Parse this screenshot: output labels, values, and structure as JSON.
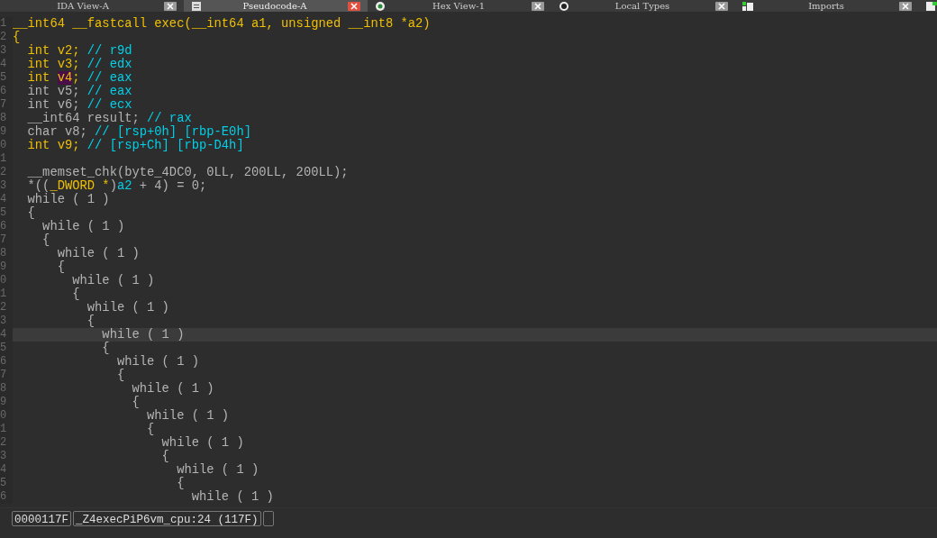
{
  "tabs": [
    {
      "label": "IDA View-A",
      "selected": false
    },
    {
      "label": "Pseudocode-A",
      "selected": true
    },
    {
      "label": "Hex View-1",
      "selected": false
    },
    {
      "label": "Local Types",
      "selected": false
    },
    {
      "label": "Imports",
      "selected": false
    }
  ],
  "code": {
    "lines": [
      {
        "number": "1",
        "current": false,
        "tokens": [
          {
            "kind": "name",
            "text": "__int64 __fastcall exec(__int64 a1, unsigned __int8 *a2)"
          }
        ]
      },
      {
        "number": "2",
        "current": false,
        "tokens": [
          {
            "kind": "name",
            "text": "{"
          }
        ]
      },
      {
        "number": "3",
        "current": false,
        "tokens": [
          {
            "kind": "name",
            "text": "  int v2; "
          },
          {
            "kind": "comment",
            "text": "// r9d"
          }
        ]
      },
      {
        "number": "4",
        "current": false,
        "tokens": [
          {
            "kind": "name",
            "text": "  int v3; "
          },
          {
            "kind": "comment",
            "text": "// edx"
          }
        ]
      },
      {
        "number": "5",
        "current": false,
        "tokens": [
          {
            "kind": "name",
            "text": "  int "
          },
          {
            "kind": "highlight",
            "text": "v4"
          },
          {
            "kind": "name",
            "text": "; "
          },
          {
            "kind": "comment",
            "text": "// eax"
          }
        ]
      },
      {
        "number": "6",
        "current": false,
        "tokens": [
          {
            "kind": "code",
            "text": "  int v5; "
          },
          {
            "kind": "comment",
            "text": "// eax"
          }
        ]
      },
      {
        "number": "7",
        "current": false,
        "tokens": [
          {
            "kind": "code",
            "text": "  int v6; "
          },
          {
            "kind": "comment",
            "text": "// ecx"
          }
        ]
      },
      {
        "number": "8",
        "current": false,
        "tokens": [
          {
            "kind": "code",
            "text": "  __int64 result; "
          },
          {
            "kind": "comment",
            "text": "// rax"
          }
        ]
      },
      {
        "number": "9",
        "current": false,
        "tokens": [
          {
            "kind": "code",
            "text": "  char v8; "
          },
          {
            "kind": "comment",
            "text": "// [rsp+0h] [rbp-E0h]"
          }
        ]
      },
      {
        "number": "0",
        "current": false,
        "tokens": [
          {
            "kind": "name",
            "text": "  int v9; "
          },
          {
            "kind": "comment",
            "text": "// [rsp+Ch] [rbp-D4h]"
          }
        ]
      },
      {
        "number": "1",
        "current": false
      },
      {
        "number": "2",
        "current": false,
        "tokens": [
          {
            "kind": "code",
            "text": "  __memset_chk(byte_4DC0, 0LL, 200LL, 200LL);"
          }
        ]
      },
      {
        "number": "3",
        "current": false,
        "tokens": [
          {
            "kind": "code",
            "text": "  *(("
          },
          {
            "kind": "name",
            "text": "_DWORD *"
          },
          {
            "kind": "code",
            "text": ")"
          },
          {
            "kind": "comment",
            "text": "a2"
          },
          {
            "kind": "code",
            "text": " + 4) = 0;"
          }
        ]
      },
      {
        "number": "4",
        "current": false,
        "tokens": [
          {
            "kind": "code",
            "text": "  while ( 1 )"
          }
        ]
      },
      {
        "number": "5",
        "current": false,
        "tokens": [
          {
            "kind": "code",
            "text": "  {"
          }
        ]
      },
      {
        "number": "6",
        "current": false,
        "tokens": [
          {
            "kind": "code",
            "text": "    while ( 1 )"
          }
        ]
      },
      {
        "number": "7",
        "current": false,
        "tokens": [
          {
            "kind": "code",
            "text": "    {"
          }
        ]
      },
      {
        "number": "8",
        "current": false,
        "tokens": [
          {
            "kind": "code",
            "text": "      while ( 1 )"
          }
        ]
      },
      {
        "number": "9",
        "current": false,
        "tokens": [
          {
            "kind": "code",
            "text": "      {"
          }
        ]
      },
      {
        "number": "0",
        "current": false,
        "tokens": [
          {
            "kind": "code",
            "text": "        while ( 1 )"
          }
        ]
      },
      {
        "number": "1",
        "current": false,
        "tokens": [
          {
            "kind": "code",
            "text": "        {"
          }
        ]
      },
      {
        "number": "2",
        "current": false,
        "tokens": [
          {
            "kind": "code",
            "text": "          while ( 1 )"
          }
        ]
      },
      {
        "number": "3",
        "current": false,
        "tokens": [
          {
            "kind": "code",
            "text": "          {"
          }
        ]
      },
      {
        "number": "4",
        "current": true,
        "tokens": [
          {
            "kind": "code",
            "text": "            while ( 1 )"
          }
        ]
      },
      {
        "number": "5",
        "current": false,
        "tokens": [
          {
            "kind": "code",
            "text": "            {"
          }
        ]
      },
      {
        "number": "6",
        "current": false,
        "tokens": [
          {
            "kind": "code",
            "text": "              while ( 1 )"
          }
        ]
      },
      {
        "number": "7",
        "current": false,
        "tokens": [
          {
            "kind": "code",
            "text": "              {"
          }
        ]
      },
      {
        "number": "8",
        "current": false,
        "tokens": [
          {
            "kind": "code",
            "text": "                while ( 1 )"
          }
        ]
      },
      {
        "number": "9",
        "current": false,
        "tokens": [
          {
            "kind": "code",
            "text": "                {"
          }
        ]
      },
      {
        "number": "0",
        "current": false,
        "tokens": [
          {
            "kind": "code",
            "text": "                  while ( 1 )"
          }
        ]
      },
      {
        "number": "1",
        "current": false,
        "tokens": [
          {
            "kind": "code",
            "text": "                  {"
          }
        ]
      },
      {
        "number": "2",
        "current": false,
        "tokens": [
          {
            "kind": "code",
            "text": "                    while ( 1 )"
          }
        ]
      },
      {
        "number": "3",
        "current": false,
        "tokens": [
          {
            "kind": "code",
            "text": "                    {"
          }
        ]
      },
      {
        "number": "4",
        "current": false,
        "tokens": [
          {
            "kind": "code",
            "text": "                      while ( 1 )"
          }
        ]
      },
      {
        "number": "5",
        "current": false,
        "tokens": [
          {
            "kind": "code",
            "text": "                      {"
          }
        ]
      },
      {
        "number": "6",
        "current": false,
        "tokens": [
          {
            "kind": "code",
            "text": "                        while ( 1 )"
          }
        ]
      }
    ]
  },
  "status_bar": {
    "address": "0000117F",
    "location": "_Z4execPiP6vm_cpu:24 (117F)"
  }
}
